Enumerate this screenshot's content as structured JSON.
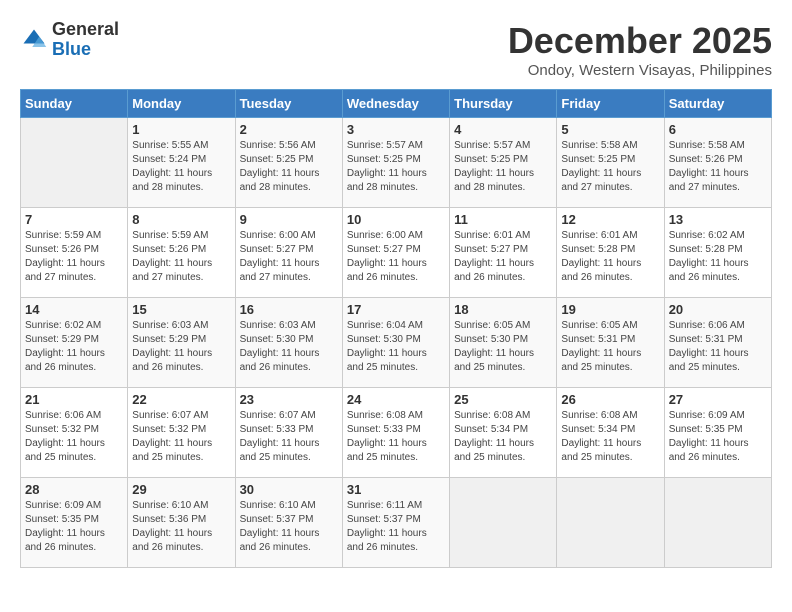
{
  "header": {
    "logo_general": "General",
    "logo_blue": "Blue",
    "month_title": "December 2025",
    "location": "Ondoy, Western Visayas, Philippines"
  },
  "weekdays": [
    "Sunday",
    "Monday",
    "Tuesday",
    "Wednesday",
    "Thursday",
    "Friday",
    "Saturday"
  ],
  "weeks": [
    [
      {
        "day": "",
        "sunrise": "",
        "sunset": "",
        "daylight": ""
      },
      {
        "day": "1",
        "sunrise": "Sunrise: 5:55 AM",
        "sunset": "Sunset: 5:24 PM",
        "daylight": "Daylight: 11 hours and 28 minutes."
      },
      {
        "day": "2",
        "sunrise": "Sunrise: 5:56 AM",
        "sunset": "Sunset: 5:25 PM",
        "daylight": "Daylight: 11 hours and 28 minutes."
      },
      {
        "day": "3",
        "sunrise": "Sunrise: 5:57 AM",
        "sunset": "Sunset: 5:25 PM",
        "daylight": "Daylight: 11 hours and 28 minutes."
      },
      {
        "day": "4",
        "sunrise": "Sunrise: 5:57 AM",
        "sunset": "Sunset: 5:25 PM",
        "daylight": "Daylight: 11 hours and 28 minutes."
      },
      {
        "day": "5",
        "sunrise": "Sunrise: 5:58 AM",
        "sunset": "Sunset: 5:25 PM",
        "daylight": "Daylight: 11 hours and 27 minutes."
      },
      {
        "day": "6",
        "sunrise": "Sunrise: 5:58 AM",
        "sunset": "Sunset: 5:26 PM",
        "daylight": "Daylight: 11 hours and 27 minutes."
      }
    ],
    [
      {
        "day": "7",
        "sunrise": "Sunrise: 5:59 AM",
        "sunset": "Sunset: 5:26 PM",
        "daylight": "Daylight: 11 hours and 27 minutes."
      },
      {
        "day": "8",
        "sunrise": "Sunrise: 5:59 AM",
        "sunset": "Sunset: 5:26 PM",
        "daylight": "Daylight: 11 hours and 27 minutes."
      },
      {
        "day": "9",
        "sunrise": "Sunrise: 6:00 AM",
        "sunset": "Sunset: 5:27 PM",
        "daylight": "Daylight: 11 hours and 27 minutes."
      },
      {
        "day": "10",
        "sunrise": "Sunrise: 6:00 AM",
        "sunset": "Sunset: 5:27 PM",
        "daylight": "Daylight: 11 hours and 26 minutes."
      },
      {
        "day": "11",
        "sunrise": "Sunrise: 6:01 AM",
        "sunset": "Sunset: 5:27 PM",
        "daylight": "Daylight: 11 hours and 26 minutes."
      },
      {
        "day": "12",
        "sunrise": "Sunrise: 6:01 AM",
        "sunset": "Sunset: 5:28 PM",
        "daylight": "Daylight: 11 hours and 26 minutes."
      },
      {
        "day": "13",
        "sunrise": "Sunrise: 6:02 AM",
        "sunset": "Sunset: 5:28 PM",
        "daylight": "Daylight: 11 hours and 26 minutes."
      }
    ],
    [
      {
        "day": "14",
        "sunrise": "Sunrise: 6:02 AM",
        "sunset": "Sunset: 5:29 PM",
        "daylight": "Daylight: 11 hours and 26 minutes."
      },
      {
        "day": "15",
        "sunrise": "Sunrise: 6:03 AM",
        "sunset": "Sunset: 5:29 PM",
        "daylight": "Daylight: 11 hours and 26 minutes."
      },
      {
        "day": "16",
        "sunrise": "Sunrise: 6:03 AM",
        "sunset": "Sunset: 5:30 PM",
        "daylight": "Daylight: 11 hours and 26 minutes."
      },
      {
        "day": "17",
        "sunrise": "Sunrise: 6:04 AM",
        "sunset": "Sunset: 5:30 PM",
        "daylight": "Daylight: 11 hours and 25 minutes."
      },
      {
        "day": "18",
        "sunrise": "Sunrise: 6:05 AM",
        "sunset": "Sunset: 5:30 PM",
        "daylight": "Daylight: 11 hours and 25 minutes."
      },
      {
        "day": "19",
        "sunrise": "Sunrise: 6:05 AM",
        "sunset": "Sunset: 5:31 PM",
        "daylight": "Daylight: 11 hours and 25 minutes."
      },
      {
        "day": "20",
        "sunrise": "Sunrise: 6:06 AM",
        "sunset": "Sunset: 5:31 PM",
        "daylight": "Daylight: 11 hours and 25 minutes."
      }
    ],
    [
      {
        "day": "21",
        "sunrise": "Sunrise: 6:06 AM",
        "sunset": "Sunset: 5:32 PM",
        "daylight": "Daylight: 11 hours and 25 minutes."
      },
      {
        "day": "22",
        "sunrise": "Sunrise: 6:07 AM",
        "sunset": "Sunset: 5:32 PM",
        "daylight": "Daylight: 11 hours and 25 minutes."
      },
      {
        "day": "23",
        "sunrise": "Sunrise: 6:07 AM",
        "sunset": "Sunset: 5:33 PM",
        "daylight": "Daylight: 11 hours and 25 minutes."
      },
      {
        "day": "24",
        "sunrise": "Sunrise: 6:08 AM",
        "sunset": "Sunset: 5:33 PM",
        "daylight": "Daylight: 11 hours and 25 minutes."
      },
      {
        "day": "25",
        "sunrise": "Sunrise: 6:08 AM",
        "sunset": "Sunset: 5:34 PM",
        "daylight": "Daylight: 11 hours and 25 minutes."
      },
      {
        "day": "26",
        "sunrise": "Sunrise: 6:08 AM",
        "sunset": "Sunset: 5:34 PM",
        "daylight": "Daylight: 11 hours and 25 minutes."
      },
      {
        "day": "27",
        "sunrise": "Sunrise: 6:09 AM",
        "sunset": "Sunset: 5:35 PM",
        "daylight": "Daylight: 11 hours and 26 minutes."
      }
    ],
    [
      {
        "day": "28",
        "sunrise": "Sunrise: 6:09 AM",
        "sunset": "Sunset: 5:35 PM",
        "daylight": "Daylight: 11 hours and 26 minutes."
      },
      {
        "day": "29",
        "sunrise": "Sunrise: 6:10 AM",
        "sunset": "Sunset: 5:36 PM",
        "daylight": "Daylight: 11 hours and 26 minutes."
      },
      {
        "day": "30",
        "sunrise": "Sunrise: 6:10 AM",
        "sunset": "Sunset: 5:37 PM",
        "daylight": "Daylight: 11 hours and 26 minutes."
      },
      {
        "day": "31",
        "sunrise": "Sunrise: 6:11 AM",
        "sunset": "Sunset: 5:37 PM",
        "daylight": "Daylight: 11 hours and 26 minutes."
      },
      {
        "day": "",
        "sunrise": "",
        "sunset": "",
        "daylight": ""
      },
      {
        "day": "",
        "sunrise": "",
        "sunset": "",
        "daylight": ""
      },
      {
        "day": "",
        "sunrise": "",
        "sunset": "",
        "daylight": ""
      }
    ]
  ]
}
